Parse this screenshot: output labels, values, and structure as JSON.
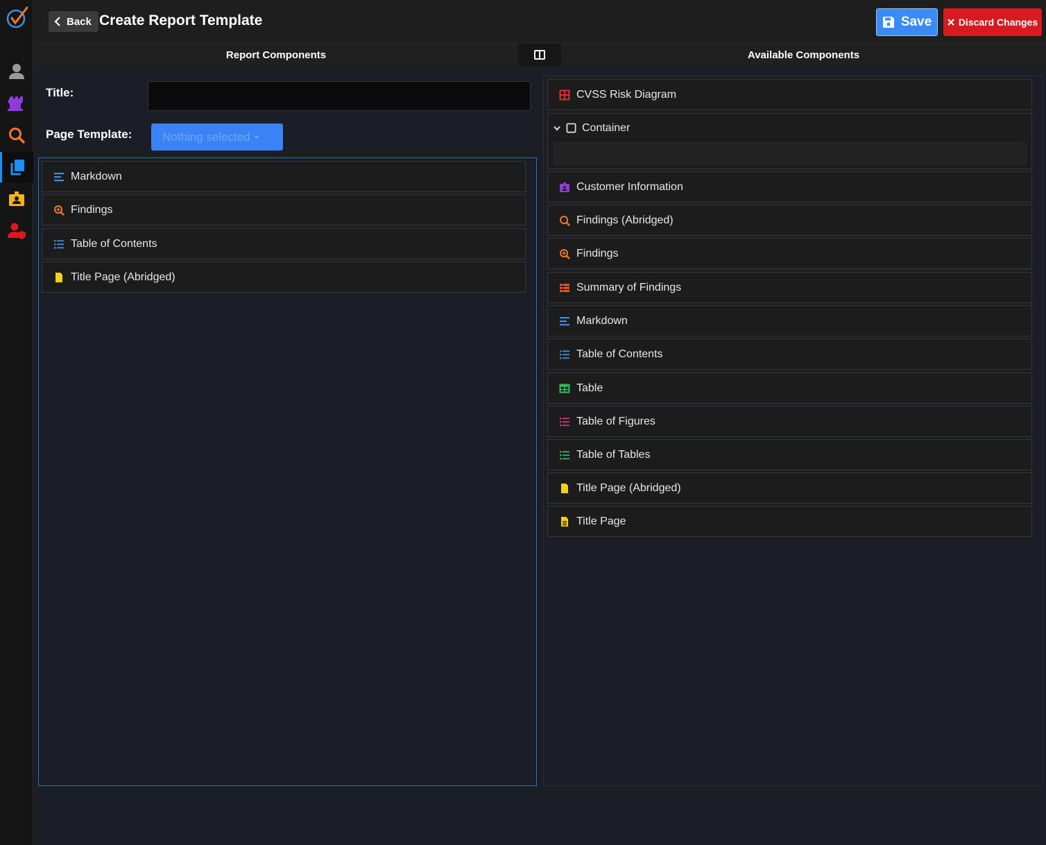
{
  "header": {
    "back_label": "Back",
    "title": "Create Report Template",
    "save_label": "Save",
    "discard_label": "Discard Changes"
  },
  "sections": {
    "report_components": "Report Components",
    "available_components": "Available Components"
  },
  "form": {
    "title_label": "Title:",
    "title_value": "",
    "page_template_label": "Page Template:",
    "page_template_value": "Nothing selected"
  },
  "report_components": [
    {
      "label": "Markdown",
      "icon": "align-left-icon",
      "color": "#3d8fe0"
    },
    {
      "label": "Findings",
      "icon": "search-plus-icon",
      "color": "#f07a2a"
    },
    {
      "label": "Table of Contents",
      "icon": "list-icon",
      "color": "#3d8fe0"
    },
    {
      "label": "Title Page (Abridged)",
      "icon": "file-icon",
      "color": "#f3d11a"
    }
  ],
  "available_components": [
    {
      "label": "CVSS Risk Diagram",
      "icon": "grid-icon",
      "color": "#e0312b"
    },
    {
      "label": "Container",
      "icon": "square-icon",
      "color": "#e8e8e8"
    },
    {
      "label": "Customer Information",
      "icon": "id-card-icon",
      "color": "#8e3bd8"
    },
    {
      "label": "Findings (Abridged)",
      "icon": "search-icon",
      "color": "#f07a2a"
    },
    {
      "label": "Findings",
      "icon": "search-plus-icon",
      "color": "#f07a2a"
    },
    {
      "label": "Summary of Findings",
      "icon": "table-list-icon",
      "color": "#f0552a"
    },
    {
      "label": "Markdown",
      "icon": "align-left-icon",
      "color": "#3d8fe0"
    },
    {
      "label": "Table of Contents",
      "icon": "list-icon",
      "color": "#3d8fe0"
    },
    {
      "label": "Table",
      "icon": "table-icon",
      "color": "#2fbf5a"
    },
    {
      "label": "Table of Figures",
      "icon": "list-icon",
      "color": "#e0307a"
    },
    {
      "label": "Table of Tables",
      "icon": "list-icon",
      "color": "#2fbf5a"
    },
    {
      "label": "Title Page (Abridged)",
      "icon": "file-icon",
      "color": "#f3d11a"
    },
    {
      "label": "Title Page",
      "icon": "file-text-icon",
      "color": "#f3d11a"
    }
  ],
  "sidebar": {
    "items": [
      {
        "name": "user-icon",
        "color": "#9a9a9a"
      },
      {
        "name": "castle-icon",
        "color": "#8e3bd8"
      },
      {
        "name": "search-icon",
        "color": "#f07a2a"
      },
      {
        "name": "copy-icon",
        "color": "#1f8ef1"
      },
      {
        "name": "id-badge-icon",
        "color": "#f3b31a"
      },
      {
        "name": "user-shield-icon",
        "color": "#d71920"
      }
    ]
  }
}
